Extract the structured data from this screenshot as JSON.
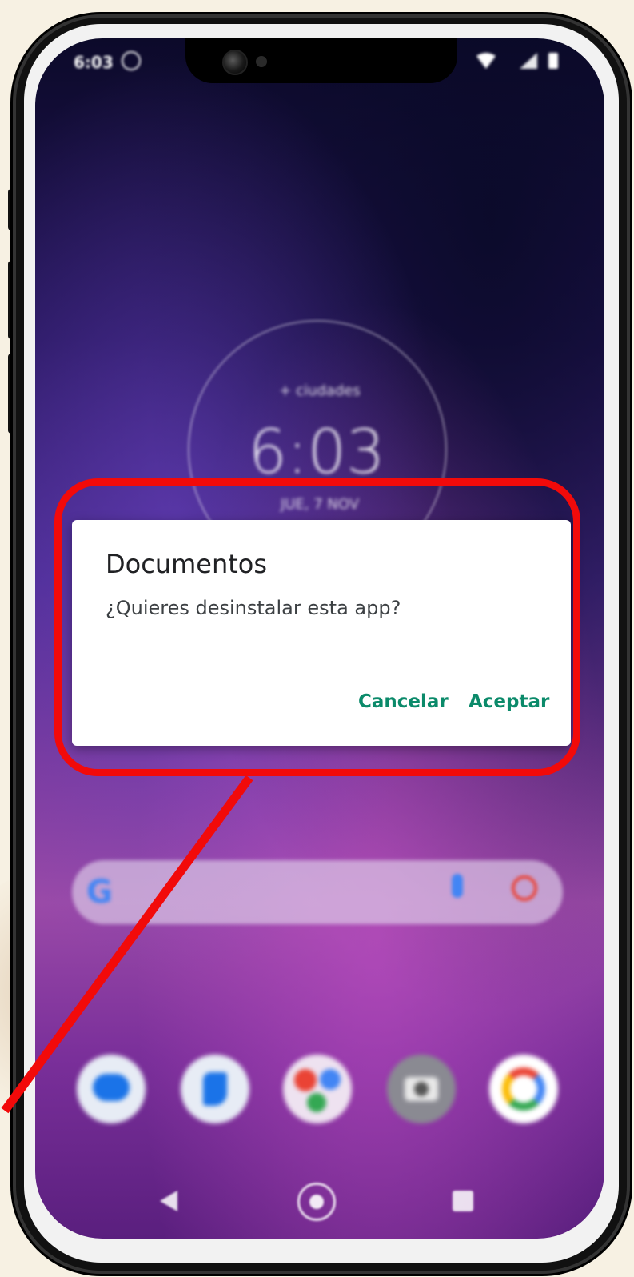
{
  "status_bar": {
    "time": "6:03",
    "left_icon": "whatsapp-icon",
    "right_icons": [
      "wifi-icon",
      "signal-icon",
      "battery-icon"
    ]
  },
  "wallpaper": {
    "clock_subtitle": "+ ciudades",
    "clock_time": "6:03",
    "clock_date": "JUE, 7 NOV"
  },
  "dialog": {
    "title": "Documentos",
    "message": "¿Quieres desinstalar esta app?",
    "cancel_label": "Cancelar",
    "accept_label": "Aceptar",
    "accent_color": "#0b8a6a"
  },
  "search_bar": {
    "logo_letter": "G",
    "icons": [
      "google-g-icon",
      "microphone-icon",
      "google-lens-icon"
    ]
  },
  "dock": {
    "icons": [
      "messages-icon",
      "phone-icon",
      "chrome-apps-folder-icon",
      "camera-icon",
      "google-icon"
    ]
  },
  "nav_bar": {
    "icons": [
      "back-icon",
      "home-icon",
      "recents-icon"
    ]
  },
  "annotation": {
    "highlight_color": "#f20a0a"
  }
}
